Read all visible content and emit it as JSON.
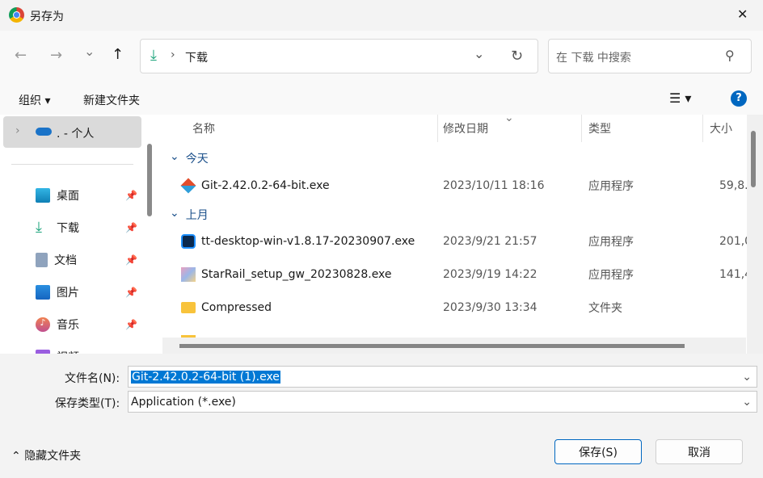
{
  "window": {
    "title": "另存为",
    "close": "✕"
  },
  "nav": {
    "back": "←",
    "forward": "→",
    "recent": "⌄",
    "up": "↑",
    "breadcrumb": "下载",
    "refresh": "↻",
    "search_placeholder": "在 下载 中搜索"
  },
  "toolbar": {
    "organize": "组织",
    "new_folder": "新建文件夹",
    "help": "?"
  },
  "sidebar": {
    "onedrive": ". - 个人",
    "items": [
      {
        "label": "桌面",
        "icon": "desktop-icon"
      },
      {
        "label": "下载",
        "icon": "download-icon"
      },
      {
        "label": "文档",
        "icon": "document-icon"
      },
      {
        "label": "图片",
        "icon": "pictures-icon"
      },
      {
        "label": "音乐",
        "icon": "music-icon"
      },
      {
        "label": "视频",
        "icon": "video-icon"
      }
    ]
  },
  "columns": {
    "name": "名称",
    "date": "修改日期",
    "type": "类型",
    "size": "大小"
  },
  "groups": [
    {
      "label": "今天",
      "files": [
        {
          "name": "Git-2.42.0.2-64-bit.exe",
          "date": "2023/10/11 18:16",
          "type": "应用程序",
          "size": "59,8..."
        }
      ]
    },
    {
      "label": "上月",
      "files": [
        {
          "name": "tt-desktop-win-v1.8.17-20230907.exe",
          "date": "2023/9/21 21:57",
          "type": "应用程序",
          "size": "201,0..."
        },
        {
          "name": "StarRail_setup_gw_20230828.exe",
          "date": "2023/9/19 14:22",
          "type": "应用程序",
          "size": "141,4..."
        },
        {
          "name": "Compressed",
          "date": "2023/9/30 13:34",
          "type": "文件夹",
          "size": ""
        }
      ]
    }
  ],
  "form": {
    "filename_label": "文件名(N):",
    "filename_value": "Git-2.42.0.2-64-bit (1).exe",
    "type_label": "保存类型(T):",
    "type_value": "Application (*.exe)"
  },
  "footer": {
    "hide_folders": "隐藏文件夹",
    "save": "保存(S)",
    "cancel": "取消"
  },
  "colors": {
    "accent": "#0067c0",
    "selection": "#0078d4"
  }
}
